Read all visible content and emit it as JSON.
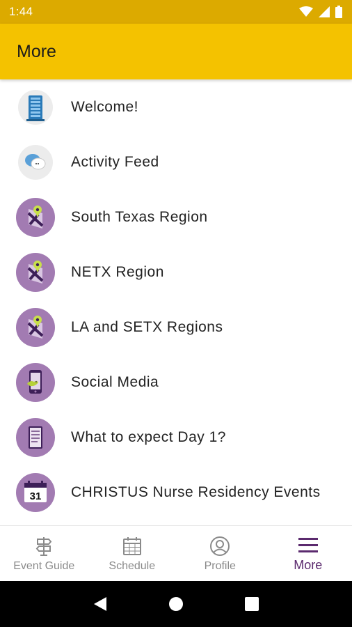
{
  "status_bar": {
    "time": "1:44"
  },
  "app_bar": {
    "title": "More"
  },
  "menu": {
    "items": [
      {
        "label": "Welcome!",
        "icon": "building-icon"
      },
      {
        "label": "Activity Feed",
        "icon": "chat-bubble-icon"
      },
      {
        "label": "South Texas Region",
        "icon": "map-pin-icon"
      },
      {
        "label": "NETX Region",
        "icon": "map-pin-icon"
      },
      {
        "label": "LA and SETX Regions",
        "icon": "map-pin-icon"
      },
      {
        "label": "Social Media",
        "icon": "phone-bird-icon"
      },
      {
        "label": "What to expect Day 1?",
        "icon": "document-icon"
      },
      {
        "label": "CHRISTUS Nurse Residency Events",
        "icon": "calendar-icon"
      }
    ],
    "calendar_day": "31"
  },
  "bottom_nav": {
    "tabs": [
      {
        "label": "Event Guide",
        "icon": "signpost-icon"
      },
      {
        "label": "Schedule",
        "icon": "calendar-grid-icon"
      },
      {
        "label": "Profile",
        "icon": "person-icon"
      },
      {
        "label": "More",
        "icon": "hamburger-menu-icon"
      }
    ],
    "active_tab": "More"
  },
  "colors": {
    "status_bar": "#dcaa00",
    "app_bar": "#f4c200",
    "icon_purple": "#a27bb2",
    "active_tab": "#5b2a6e",
    "inactive_tab": "#8a8a8a"
  }
}
